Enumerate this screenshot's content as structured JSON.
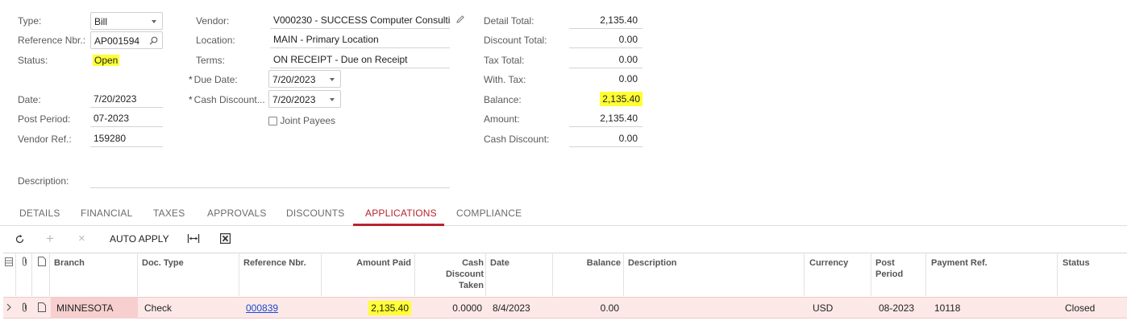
{
  "summary": {
    "type": {
      "label": "Type:",
      "value": "Bill"
    },
    "reference_nbr": {
      "label": "Reference Nbr.:",
      "value": "AP001594"
    },
    "status": {
      "label": "Status:",
      "value": "Open"
    },
    "date": {
      "label": "Date:",
      "value": "7/20/2023"
    },
    "post_period": {
      "label": "Post Period:",
      "value": "07-2023"
    },
    "vendor_ref": {
      "label": "Vendor Ref.:",
      "value": "159280"
    },
    "description": {
      "label": "Description:",
      "value": ""
    },
    "vendor": {
      "label": "Vendor:",
      "value": "V000230 - SUCCESS Computer Consulti"
    },
    "location": {
      "label": "Location:",
      "value": "MAIN - Primary Location"
    },
    "terms": {
      "label": "Terms:",
      "value": "ON RECEIPT - Due on Receipt"
    },
    "due_date": {
      "label": "Due Date:",
      "value": "7/20/2023"
    },
    "cash_discount_date": {
      "label": "Cash Discount...",
      "value": "7/20/2023"
    },
    "joint_payees": {
      "label": "Joint Payees",
      "checked": false
    },
    "required_marker": "*"
  },
  "totals": {
    "detail_total": {
      "label": "Detail Total:",
      "value": "2,135.40"
    },
    "discount_total": {
      "label": "Discount Total:",
      "value": "0.00"
    },
    "tax_total": {
      "label": "Tax Total:",
      "value": "0.00"
    },
    "with_tax": {
      "label": "With. Tax:",
      "value": "0.00"
    },
    "balance": {
      "label": "Balance:",
      "value": "2,135.40"
    },
    "amount": {
      "label": "Amount:",
      "value": "2,135.40"
    },
    "cash_discount": {
      "label": "Cash Discount:",
      "value": "0.00"
    }
  },
  "tabs": [
    {
      "label": "DETAILS"
    },
    {
      "label": "FINANCIAL"
    },
    {
      "label": "TAXES"
    },
    {
      "label": "APPROVALS"
    },
    {
      "label": "DISCOUNTS"
    },
    {
      "label": "APPLICATIONS",
      "active": true
    },
    {
      "label": "COMPLIANCE"
    }
  ],
  "toolbar": {
    "auto_apply_label": "AUTO APPLY",
    "icons": [
      "refresh-icon",
      "add-icon",
      "delete-icon",
      "fit-columns-icon",
      "excel-export-icon"
    ]
  },
  "grid": {
    "columns": {
      "branch": "Branch",
      "doc_type": "Doc. Type",
      "reference_nbr": "Reference Nbr.",
      "amount_paid": "Amount Paid",
      "cash_discount_taken_1": "Cash",
      "cash_discount_taken_2": "Discount",
      "cash_discount_taken_3": "Taken",
      "date": "Date",
      "balance": "Balance",
      "description": "Description",
      "currency": "Currency",
      "post_period_1": "Post",
      "post_period_2": "Period",
      "payment_ref": "Payment Ref.",
      "status": "Status"
    },
    "rows": [
      {
        "branch": "MINNESOTA",
        "doc_type": "Check",
        "reference_nbr": "000839",
        "amount_paid": "2,135.40",
        "cash_discount_taken": "0.0000",
        "date": "8/4/2023",
        "balance": "0.00",
        "description": "",
        "currency": "USD",
        "post_period": "08-2023",
        "payment_ref": "10118",
        "status": "Closed"
      }
    ]
  },
  "colors": {
    "highlight": "#ffff33",
    "accent": "#b8232f",
    "link": "#1a4bd1",
    "selected_row": "#fde8e8"
  }
}
